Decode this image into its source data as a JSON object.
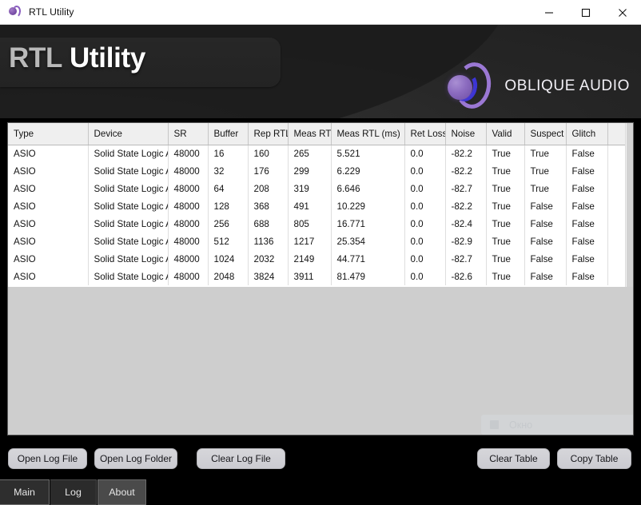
{
  "window": {
    "title": "RTL Utility",
    "icon": "oblique-audio-logo-icon",
    "controls": {
      "minimize": "—",
      "maximize": "☐",
      "close": "✕"
    }
  },
  "header": {
    "title_part1": "RTL ",
    "title_part2": "Utility",
    "brand_name": "OBLIQUE AUDIO",
    "brand_colors": {
      "purple": "#9b78d4",
      "blue": "#3b35d6",
      "bead": "#8b6bbf"
    }
  },
  "table": {
    "columns": [
      "Type",
      "Device",
      "SR",
      "Buffer",
      "Rep RTL",
      "Meas RTL",
      "Meas RTL (ms)",
      "Ret Loss",
      "Noise",
      "Valid",
      "Suspect",
      "Glitch",
      ""
    ],
    "rows": [
      [
        "ASIO",
        "Solid State Logic AS",
        "48000",
        "16",
        "160",
        "265",
        "5.521",
        "0.0",
        "-82.2",
        "True",
        "True",
        "False",
        ""
      ],
      [
        "ASIO",
        "Solid State Logic AS",
        "48000",
        "32",
        "176",
        "299",
        "6.229",
        "0.0",
        "-82.2",
        "True",
        "True",
        "False",
        ""
      ],
      [
        "ASIO",
        "Solid State Logic AS",
        "48000",
        "64",
        "208",
        "319",
        "6.646",
        "0.0",
        "-82.7",
        "True",
        "True",
        "False",
        ""
      ],
      [
        "ASIO",
        "Solid State Logic AS",
        "48000",
        "128",
        "368",
        "491",
        "10.229",
        "0.0",
        "-82.2",
        "True",
        "False",
        "False",
        ""
      ],
      [
        "ASIO",
        "Solid State Logic AS",
        "48000",
        "256",
        "688",
        "805",
        "16.771",
        "0.0",
        "-82.4",
        "True",
        "False",
        "False",
        ""
      ],
      [
        "ASIO",
        "Solid State Logic AS",
        "48000",
        "512",
        "1136",
        "1217",
        "25.354",
        "0.0",
        "-82.9",
        "True",
        "False",
        "False",
        ""
      ],
      [
        "ASIO",
        "Solid State Logic AS",
        "48000",
        "1024",
        "2032",
        "2149",
        "44.771",
        "0.0",
        "-82.7",
        "True",
        "False",
        "False",
        ""
      ],
      [
        "ASIO",
        "Solid State Logic AS",
        "48000",
        "2048",
        "3824",
        "3911",
        "81.479",
        "0.0",
        "-82.6",
        "True",
        "False",
        "False",
        ""
      ]
    ]
  },
  "ghost_widget": {
    "label": "Окно",
    "icon": "window-square-icon"
  },
  "actions": {
    "open_log_file": "Open Log File",
    "open_log_folder": "Open Log Folder",
    "clear_log_file": "Clear Log File",
    "clear_table": "Clear Table",
    "copy_table": "Copy Table"
  },
  "tabs": [
    {
      "label": "Main",
      "selected": true
    },
    {
      "label": "Log",
      "selected": false
    },
    {
      "label": "About",
      "selected": false
    }
  ]
}
